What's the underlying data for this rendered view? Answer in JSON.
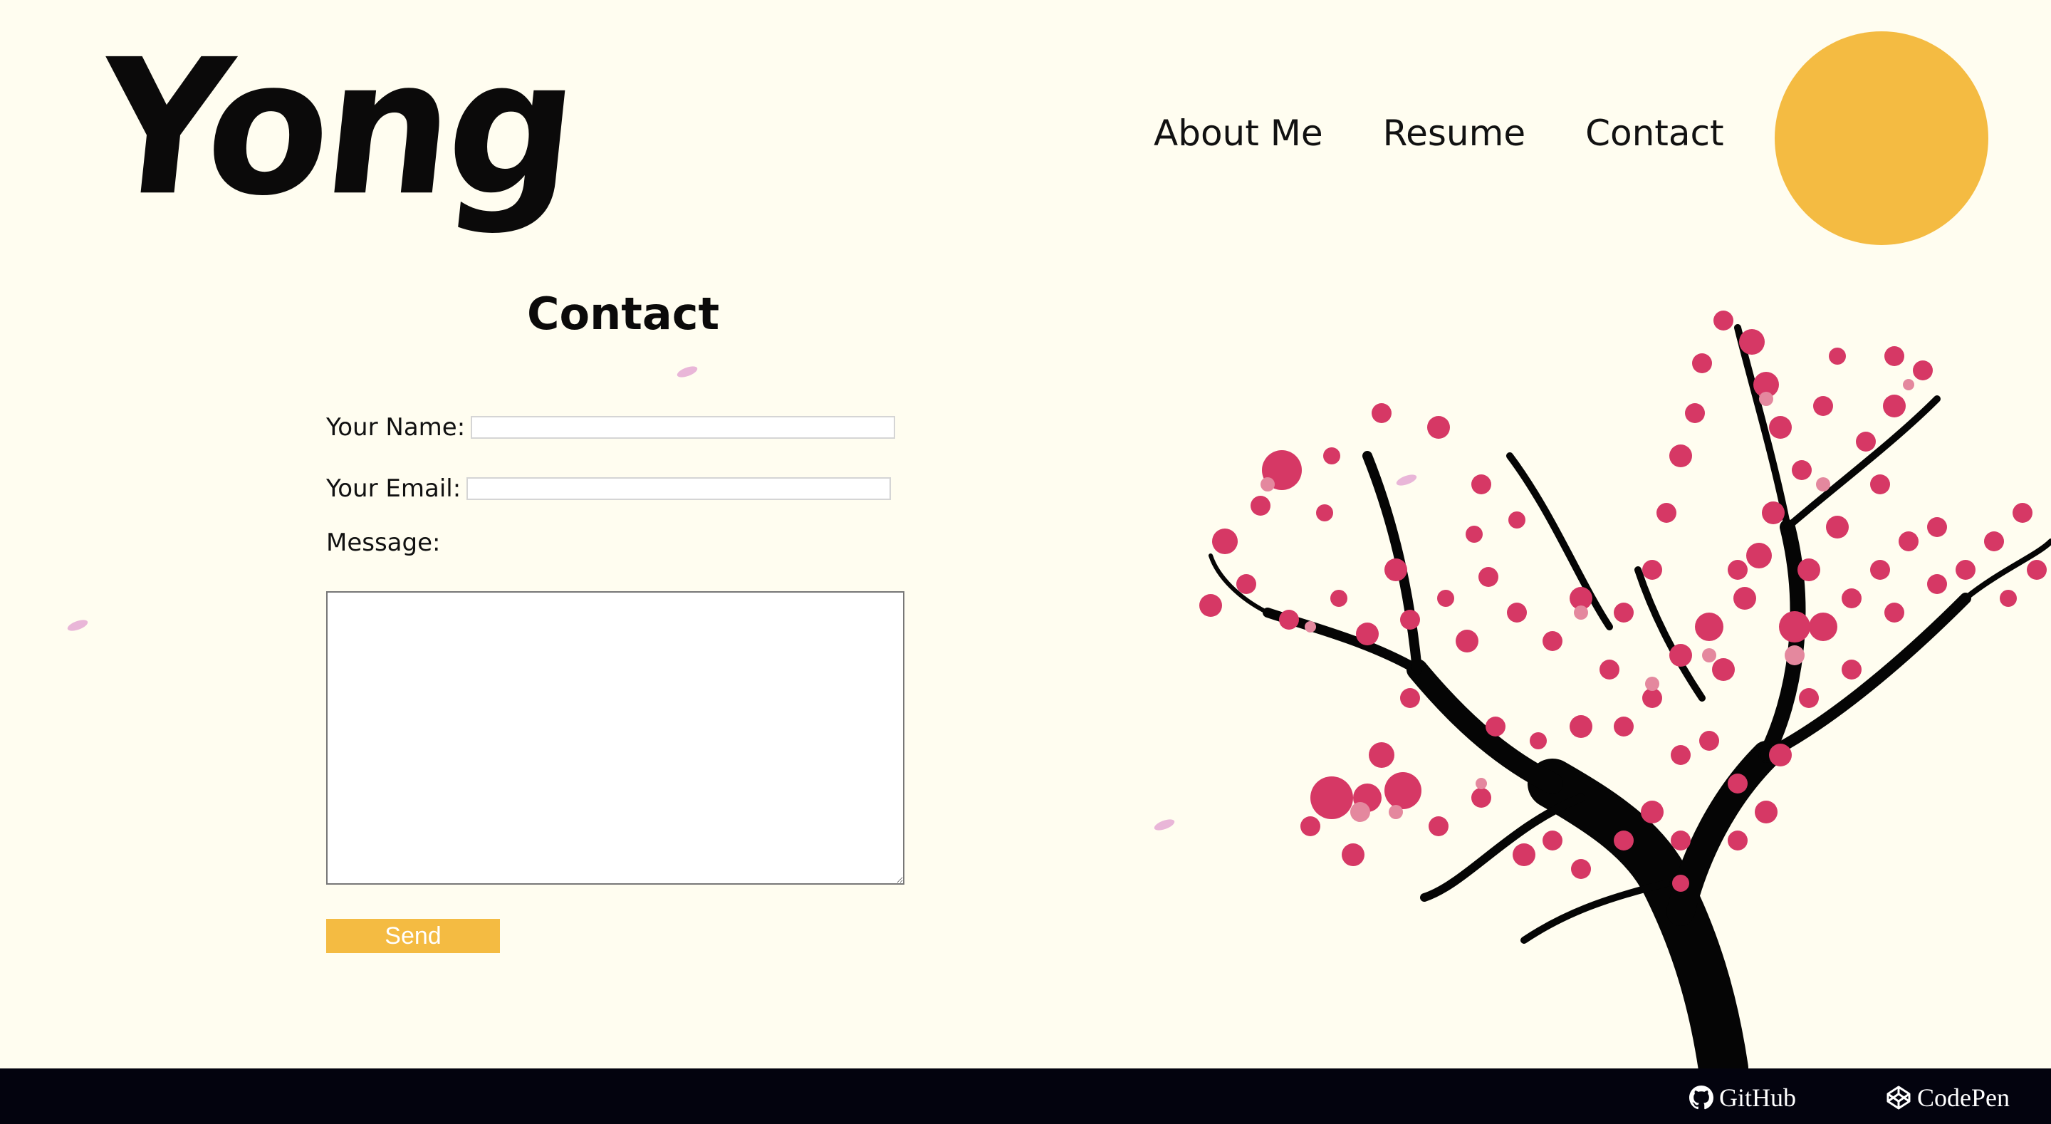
{
  "brand": {
    "logo_text": "Yong"
  },
  "nav": {
    "items": [
      "About Me",
      "Resume",
      "Contact"
    ]
  },
  "colors": {
    "background": "#fffdf0",
    "accent": "#f4bb42",
    "blossom": "#d63865",
    "footer": "#03030e"
  },
  "page": {
    "title": "Contact"
  },
  "form": {
    "name_label": "Your Name:",
    "name_value": "",
    "email_label": "Your Email:",
    "email_value": "",
    "message_label": "Message:",
    "message_value": "",
    "send_label": "Send"
  },
  "footer": {
    "links": [
      {
        "label": "GitHub",
        "icon": "github-icon"
      },
      {
        "label": "CodePen",
        "icon": "codepen-icon"
      }
    ]
  }
}
